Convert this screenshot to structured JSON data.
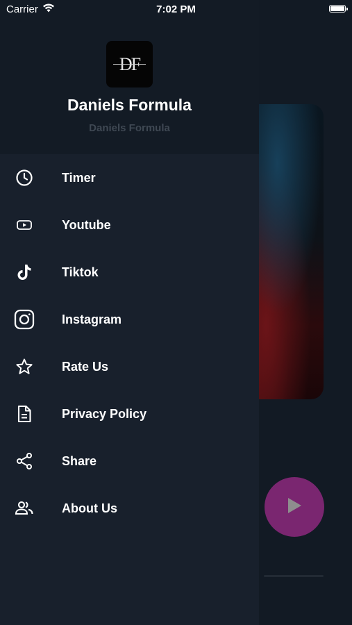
{
  "status_bar": {
    "carrier": "Carrier",
    "time": "7:02 PM",
    "battery_level": 1.0
  },
  "drawer": {
    "logo_text": "DF",
    "title": "Daniels Formula",
    "subtitle": "Daniels Formula",
    "items": [
      {
        "label": "Timer",
        "icon": "clock-icon"
      },
      {
        "label": "Youtube",
        "icon": "youtube-icon"
      },
      {
        "label": "Tiktok",
        "icon": "tiktok-icon"
      },
      {
        "label": "Instagram",
        "icon": "instagram-icon"
      },
      {
        "label": "Rate Us",
        "icon": "star-icon"
      },
      {
        "label": "Privacy Policy",
        "icon": "document-icon"
      },
      {
        "label": "Share",
        "icon": "share-icon"
      },
      {
        "label": "About Us",
        "icon": "people-icon"
      }
    ]
  },
  "colors": {
    "drawer_bg": "#18202c",
    "header_bg": "#131b25",
    "play_button": "#7a2670",
    "subtitle": "#3f4853"
  }
}
